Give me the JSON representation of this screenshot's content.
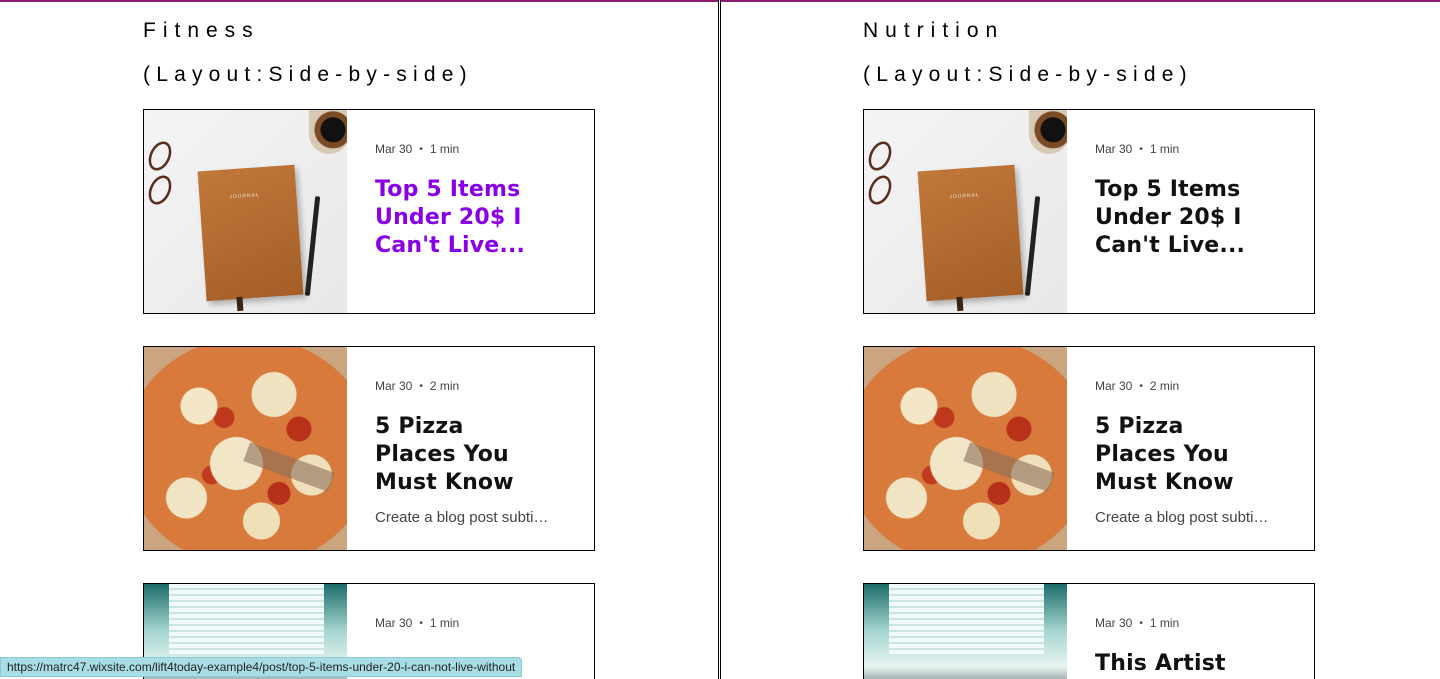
{
  "columns": [
    {
      "title": "Fitness",
      "layout_note": "(Layout:Side-by-side)",
      "posts": [
        {
          "date": "Mar 30",
          "read_time": "1 min",
          "title": "Top 5 Items Under 20$ I Can't Live...",
          "excerpt": "",
          "image": "journal-photo"
        },
        {
          "date": "Mar 30",
          "read_time": "2 min",
          "title": "5 Pizza Places You Must Know",
          "excerpt": "Create a blog post subti…",
          "image": "pizza-photo"
        },
        {
          "date": "Mar 30",
          "read_time": "1 min",
          "title": "",
          "excerpt": "",
          "image": "concert-photo"
        }
      ]
    },
    {
      "title": "Nutrition",
      "layout_note": "(Layout:Side-by-side)",
      "posts": [
        {
          "date": "Mar 30",
          "read_time": "1 min",
          "title": "Top 5 Items Under 20$ I Can't Live...",
          "excerpt": "",
          "image": "journal-photo"
        },
        {
          "date": "Mar 30",
          "read_time": "2 min",
          "title": "5 Pizza Places You Must Know",
          "excerpt": "Create a blog post subti…",
          "image": "pizza-photo"
        },
        {
          "date": "Mar 30",
          "read_time": "1 min",
          "title": "This Artist Will",
          "excerpt": "",
          "image": "concert-photo"
        }
      ]
    }
  ],
  "meta_separator": "•",
  "status_url": "https://matrc47.wixsite.com/lift4today-example4/post/top-5-items-under-20-i-can-not-live-without",
  "colors": {
    "hover_title": "#8a00e6",
    "accent_line": "#8a1b6e",
    "statusbar_bg": "#a9dde6"
  }
}
